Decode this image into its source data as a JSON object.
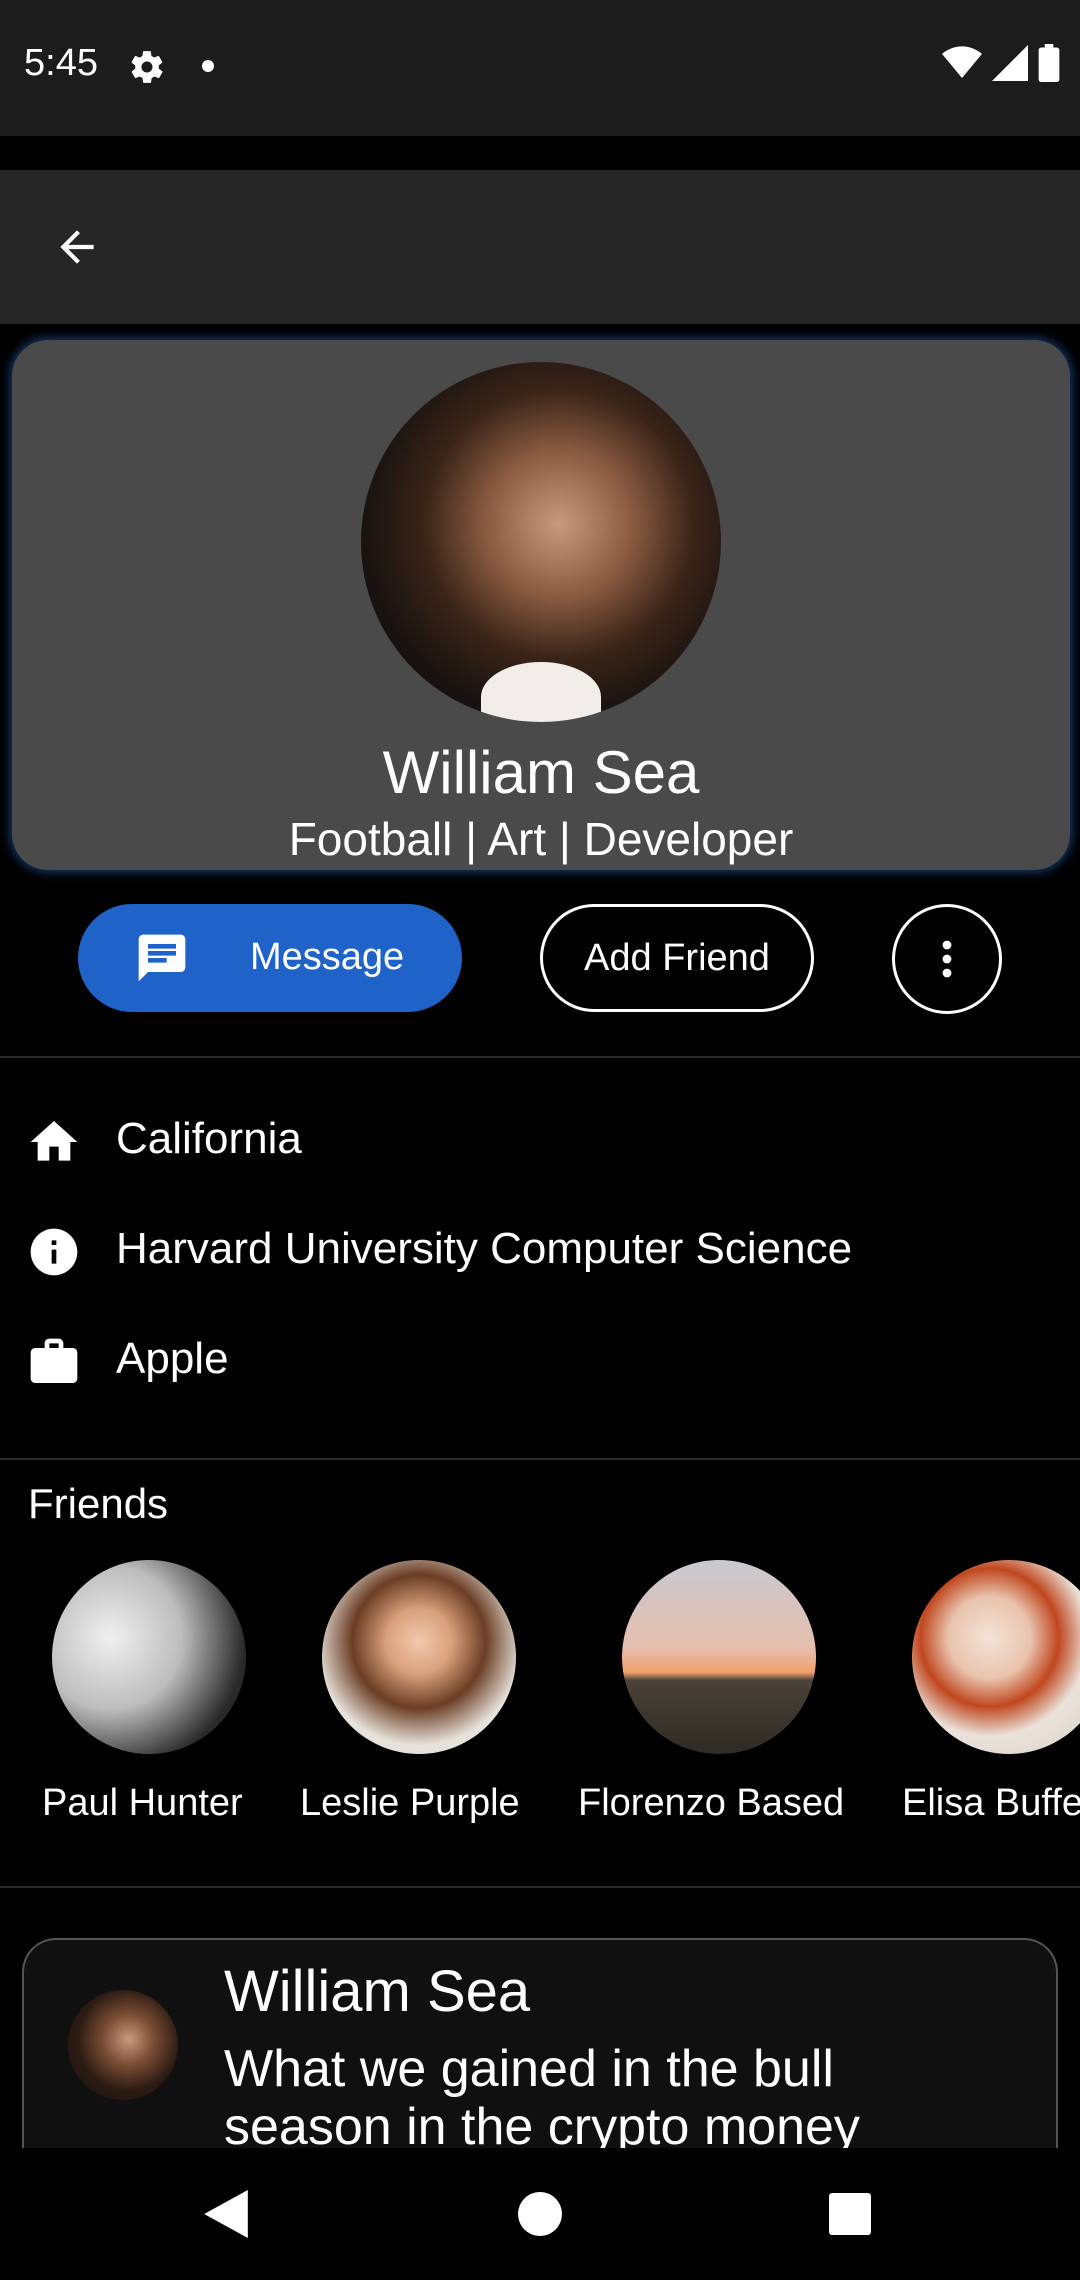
{
  "status_bar": {
    "time": "5:45",
    "icons": [
      "gear-icon",
      "dot-icon",
      "wifi-icon",
      "signal-icon",
      "battery-icon"
    ]
  },
  "app_bar": {
    "back_icon": "arrow-back-icon"
  },
  "profile": {
    "name": "William Sea",
    "tags": "Football | Art | Developer"
  },
  "actions": {
    "message_label": "Message",
    "add_friend_label": "Add Friend",
    "more_icon": "more-vert-icon"
  },
  "info": {
    "location": "California",
    "education": "Harvard University Computer Science",
    "work": "Apple"
  },
  "friends": {
    "title": "Friends",
    "items": [
      {
        "name": "Paul Hunter"
      },
      {
        "name": "Leslie Purple"
      },
      {
        "name": "Florenzo Based"
      },
      {
        "name": "Elisa Buffe"
      }
    ]
  },
  "post": {
    "author": "William Sea",
    "text": "What we gained in the bull season in the crypto money"
  },
  "colors": {
    "accent": "#1f63c9",
    "card": "#4a4a4a",
    "app_bar": "#262626",
    "status_bar": "#1c1c1c"
  }
}
